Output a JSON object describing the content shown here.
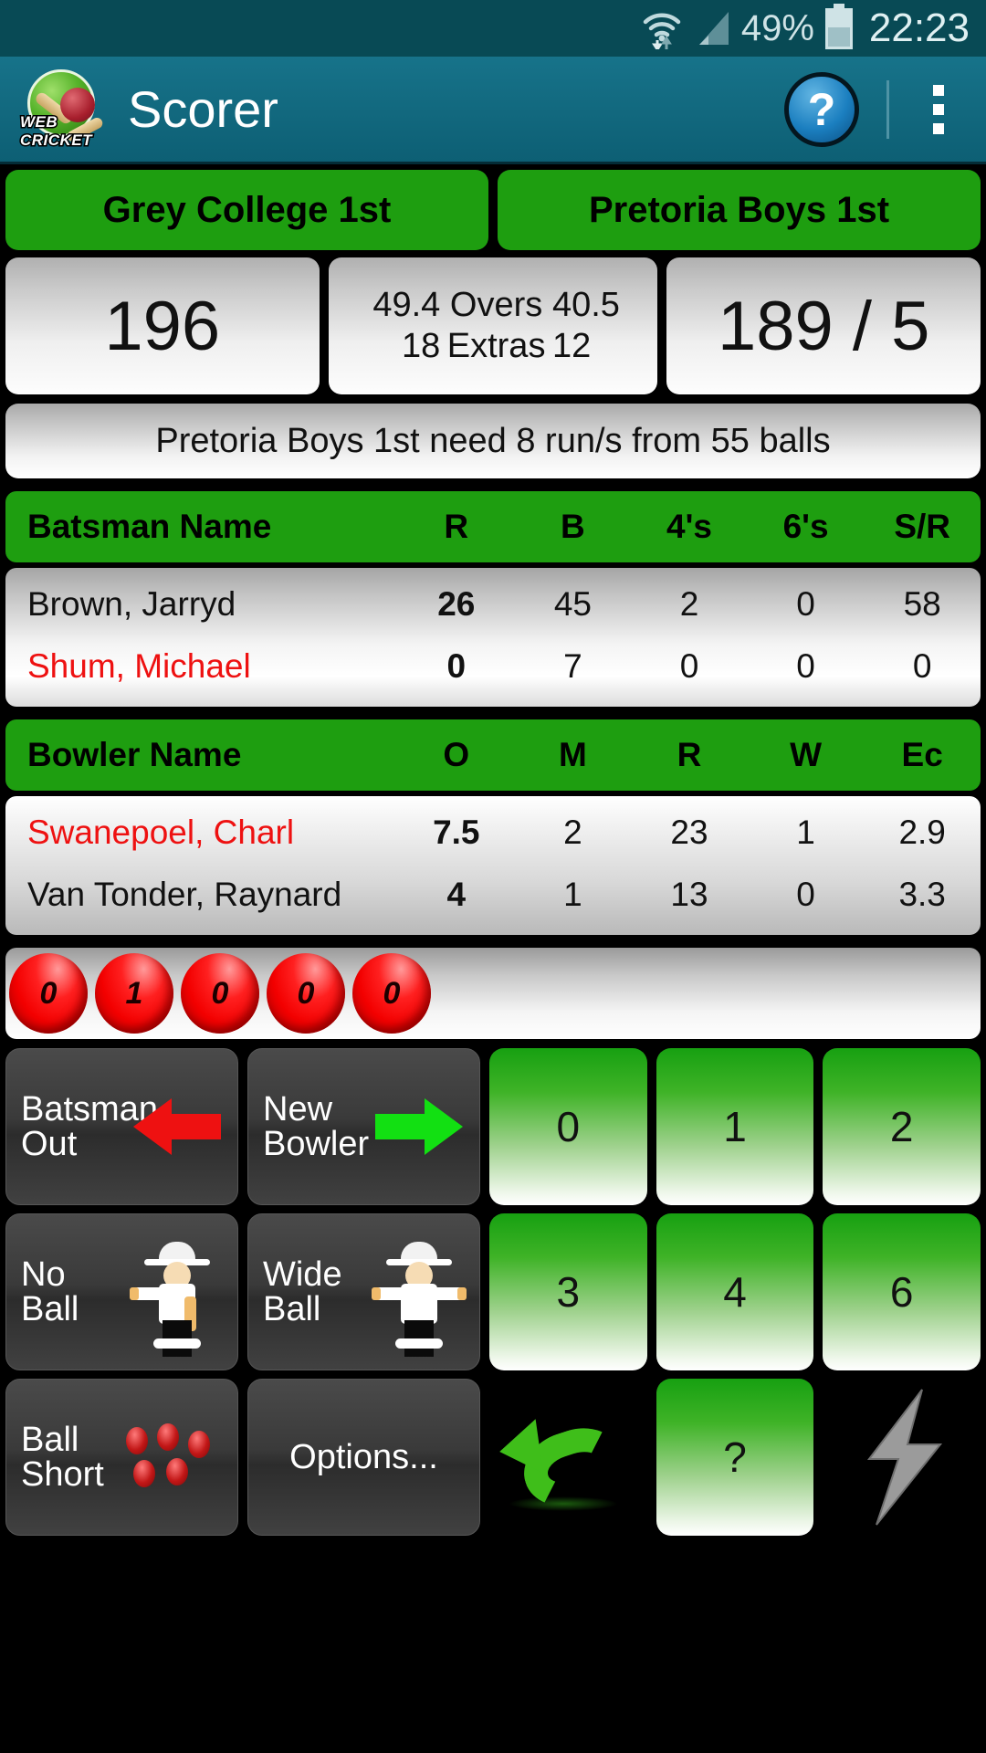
{
  "status_bar": {
    "battery_percent": "49%",
    "time": "22:23",
    "icons": [
      "wifi-icon",
      "signal-icon",
      "battery-icon"
    ]
  },
  "action_bar": {
    "app_title": "Scorer",
    "logo_top_text": "WEB",
    "logo_bottom_text": "CRICKET",
    "help_label": "?",
    "overflow_label": "⋮"
  },
  "teams": [
    {
      "label": "Grey College 1st"
    },
    {
      "label": "Pretoria Boys 1st"
    }
  ],
  "score": {
    "left_total": "196",
    "right_total": "189 / 5",
    "overs_label": "Overs",
    "overs_left": "49.4",
    "overs_right": "40.5",
    "extras_label": "Extras",
    "extras_left": "18",
    "extras_right": "12"
  },
  "status_message": "Pretoria Boys 1st need 8 run/s from 55 balls",
  "batsman_table": {
    "headers": [
      "Batsman Name",
      "R",
      "B",
      "4's",
      "6's",
      "S/R"
    ],
    "rows": [
      {
        "name": "Brown, Jarryd",
        "r": "26",
        "b": "45",
        "fours": "2",
        "sixes": "0",
        "sr": "58",
        "striker": false
      },
      {
        "name": "Shum, Michael",
        "r": "0",
        "b": "7",
        "fours": "0",
        "sixes": "0",
        "sr": "0",
        "striker": true
      }
    ]
  },
  "bowler_table": {
    "headers": [
      "Bowler Name",
      "O",
      "M",
      "R",
      "W",
      "Ec"
    ],
    "rows": [
      {
        "name": "Swanepoel, Charl",
        "o": "7.5",
        "m": "2",
        "r": "23",
        "w": "1",
        "ec": "2.9",
        "current": true
      },
      {
        "name": "Van Tonder, Raynard",
        "o": "4",
        "m": "1",
        "r": "13",
        "w": "0",
        "ec": "3.3",
        "current": false
      }
    ]
  },
  "this_over": {
    "balls": [
      "0",
      "1",
      "0",
      "0",
      "0"
    ]
  },
  "keypad": {
    "batsman_out": "Batsman\nOut",
    "new_bowler": "New\nBowler",
    "no_ball": "No\nBall",
    "wide_ball": "Wide\nBall",
    "ball_short": "Ball\nShort",
    "options": "Options...",
    "run_buttons": [
      "0",
      "1",
      "2",
      "3",
      "4",
      "6"
    ],
    "help_run_button": "?",
    "undo_icon": "undo-arrow-icon",
    "lightning_icon": "lightning-bolt-icon"
  },
  "colors": {
    "accent_green": "#1e9e10",
    "action_bar": "#12708a",
    "status_bar": "#084a55",
    "striker_red": "#ee1111",
    "ball_red": "#f30000"
  }
}
